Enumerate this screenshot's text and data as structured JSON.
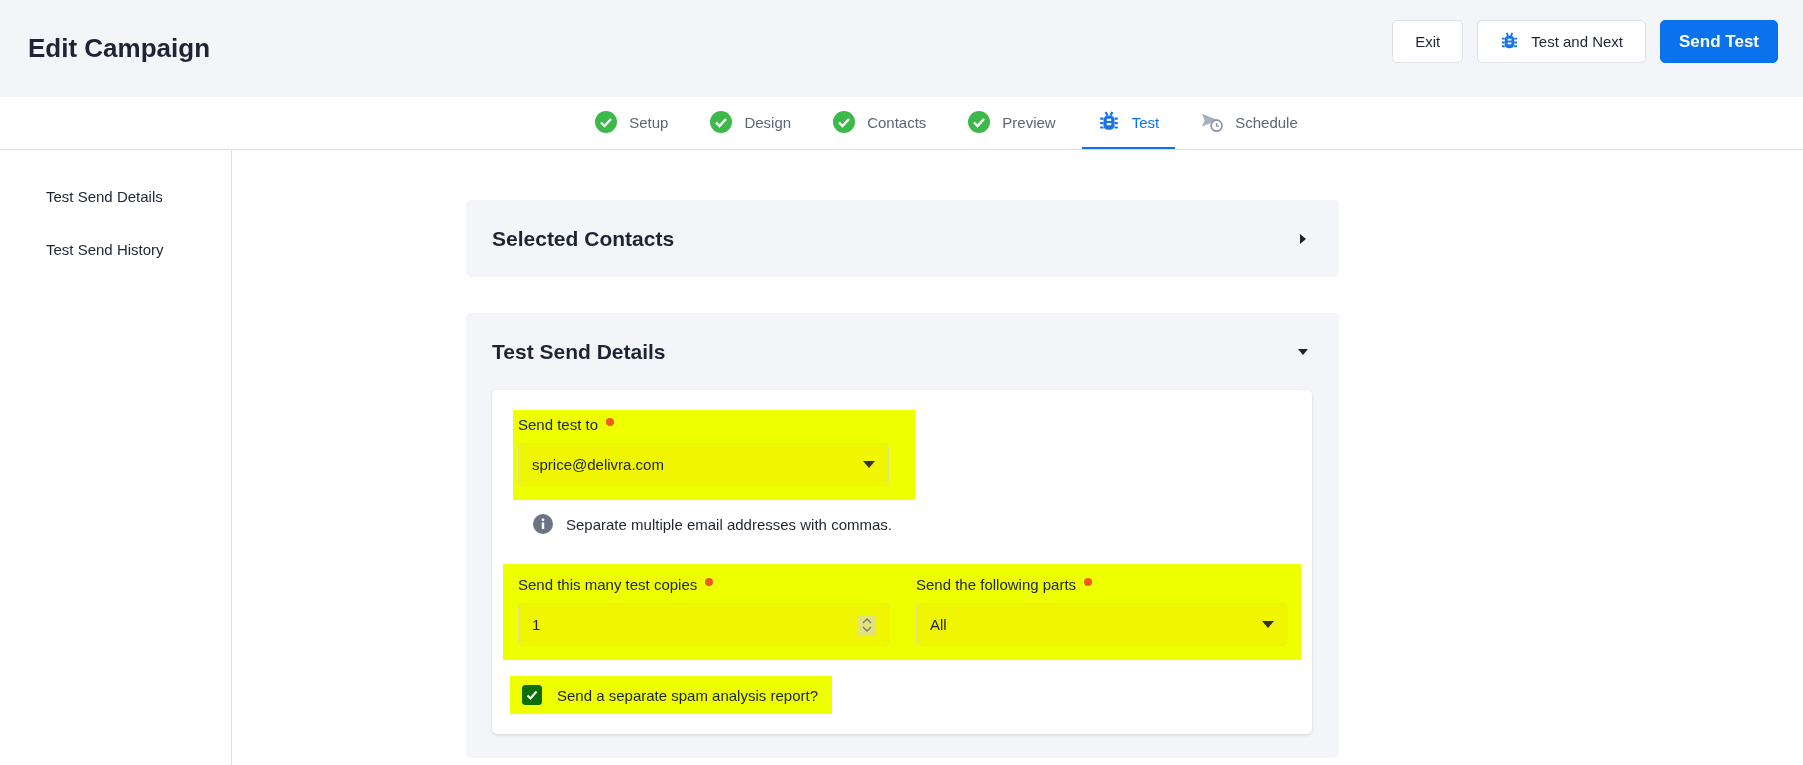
{
  "header": {
    "title": "Edit Campaign",
    "buttons": [
      {
        "label": "Exit",
        "kind": "plain"
      },
      {
        "label": "Test and Next",
        "kind": "icon"
      },
      {
        "label": "Send Test",
        "kind": "primary"
      }
    ]
  },
  "steps": [
    {
      "label": "Setup",
      "kind": "done",
      "selected": false
    },
    {
      "label": "Design",
      "kind": "done",
      "selected": false
    },
    {
      "label": "Contacts",
      "kind": "done",
      "selected": false
    },
    {
      "label": "Preview",
      "kind": "done",
      "selected": false
    },
    {
      "label": "Test",
      "kind": "test",
      "selected": true
    },
    {
      "label": "Schedule",
      "kind": "schedule",
      "selected": false
    }
  ],
  "sidebar": {
    "items": [
      {
        "label": "Test Send Details"
      },
      {
        "label": "Test Send History"
      }
    ]
  },
  "sections": [
    {
      "title": "Selected Contacts",
      "expanded": false
    },
    {
      "title": "Test Send Details",
      "expanded": true
    }
  ],
  "form": {
    "send_to": {
      "label": "Send test to",
      "required": true,
      "value": "sprice@delivra.com",
      "highlighted": true
    },
    "hint": "Separate multiple email addresses with commas.",
    "copies": {
      "label": "Send this many test copies",
      "required": true,
      "value": "1"
    },
    "parts": {
      "label": "Send the following parts",
      "required": true,
      "value": "All"
    },
    "row_highlighted": true,
    "spam_report": {
      "label": "Send a separate spam analysis report?",
      "checked": true,
      "highlighted": true
    }
  }
}
